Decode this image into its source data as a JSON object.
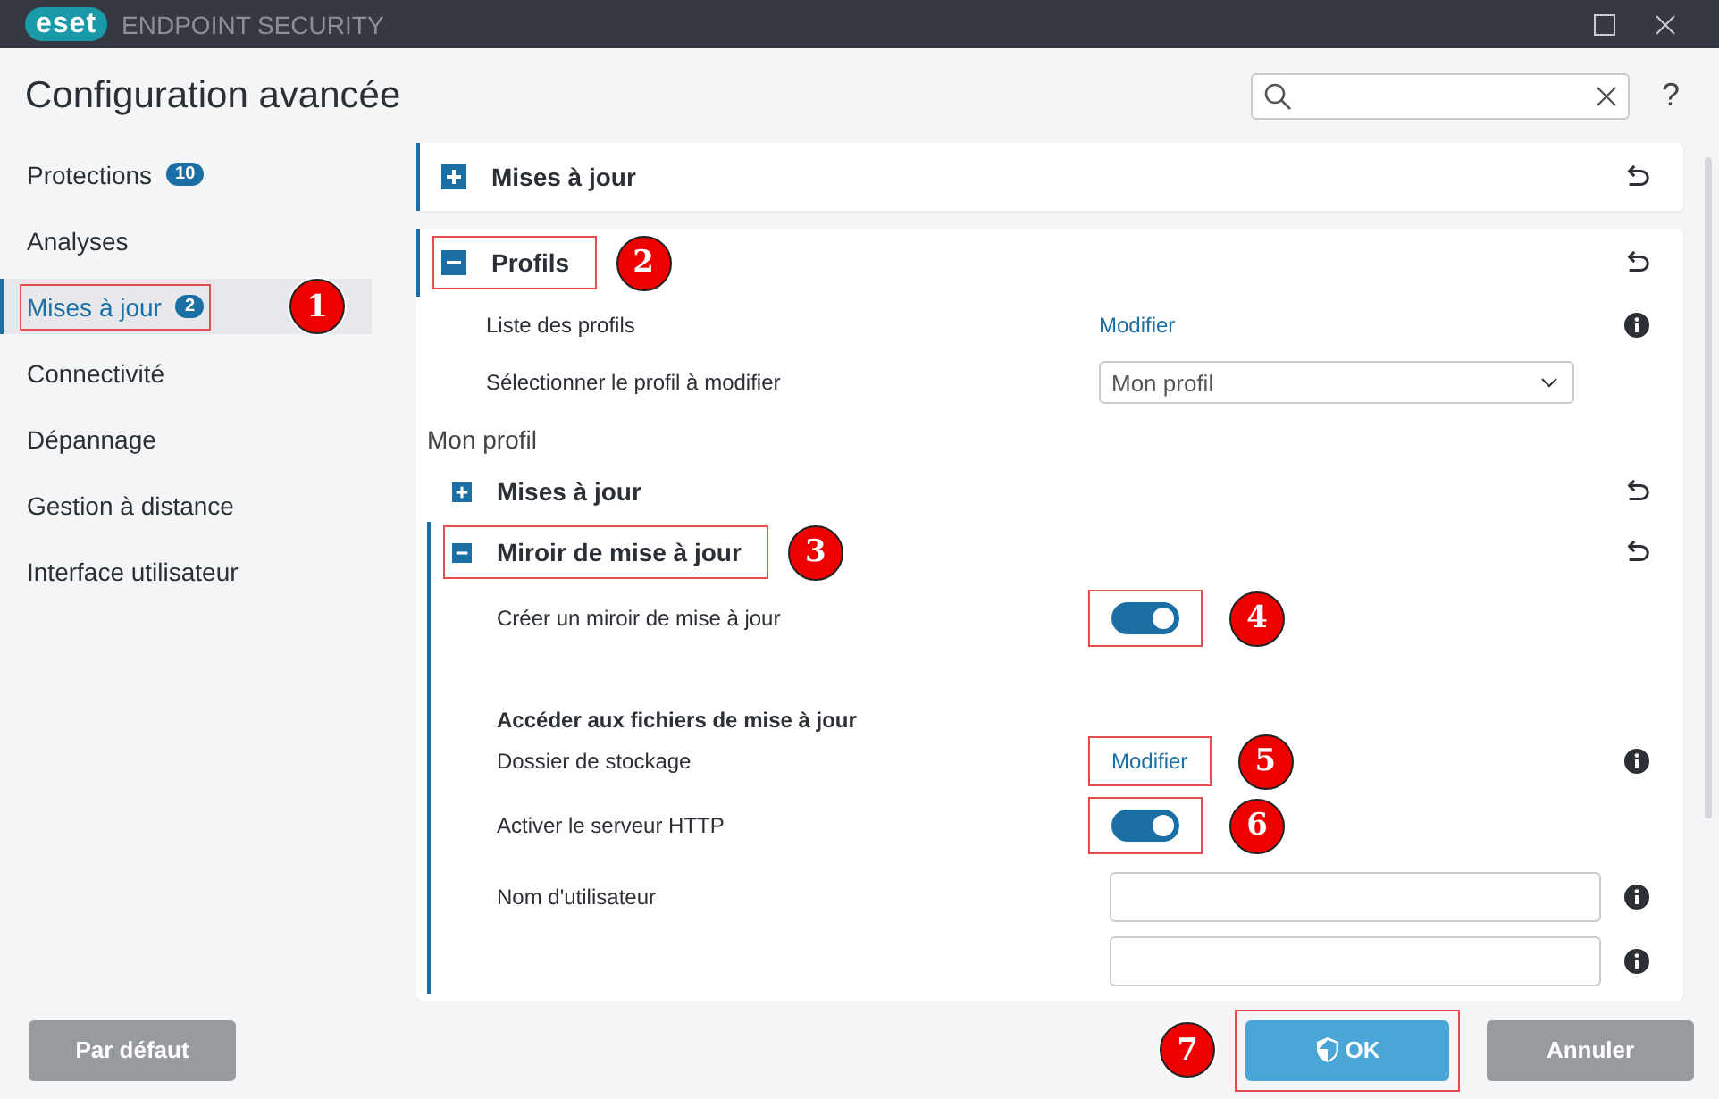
{
  "window": {
    "logo": "eset",
    "title": "ENDPOINT SECURITY"
  },
  "header": {
    "title": "Configuration avancée",
    "help": "?"
  },
  "sidebar": {
    "items": [
      {
        "label": "Protections",
        "badge": "10",
        "selected": false
      },
      {
        "label": "Analyses",
        "selected": false
      },
      {
        "label": "Mises à jour",
        "badge": "2",
        "selected": true,
        "callout": "1"
      },
      {
        "label": "Connectivité",
        "selected": false
      },
      {
        "label": "Dépannage",
        "selected": false
      },
      {
        "label": "Gestion à distance",
        "selected": false
      },
      {
        "label": "Interface utilisateur",
        "selected": false
      }
    ]
  },
  "sections": [
    {
      "title": "Mises à jour",
      "expanded": false
    },
    {
      "title": "Profils",
      "expanded": true,
      "callout": "2",
      "rows": [
        {
          "kind": "link",
          "label": "Liste des profils",
          "value": "Modifier",
          "info": true
        },
        {
          "kind": "dropdown",
          "label": "Sélectionner le profil à modifier",
          "value": "Mon profil"
        }
      ],
      "subheading": "Mon profil",
      "subsections": [
        {
          "title": "Mises à jour",
          "expanded": false
        },
        {
          "title": "Miroir de mise à jour",
          "expanded": true,
          "callout": "3",
          "rows": [
            {
              "kind": "toggle",
              "label": "Créer un miroir de mise à jour",
              "on": true,
              "callout": "4"
            },
            {
              "kind": "heading",
              "label": "Accéder aux fichiers de mise à jour"
            },
            {
              "kind": "link",
              "label": "Dossier de stockage",
              "value": "Modifier",
              "info": true,
              "callout": "5"
            },
            {
              "kind": "toggle",
              "label": "Activer le serveur HTTP",
              "on": true,
              "callout": "6"
            },
            {
              "kind": "field",
              "label": "Nom d'utilisateur",
              "info": true
            },
            {
              "kind": "field",
              "info": true
            }
          ]
        }
      ]
    }
  ],
  "footer": {
    "default_button": "Par défaut",
    "ok_button": "OK",
    "ok_callout": "7",
    "cancel_button": "Annuler"
  }
}
